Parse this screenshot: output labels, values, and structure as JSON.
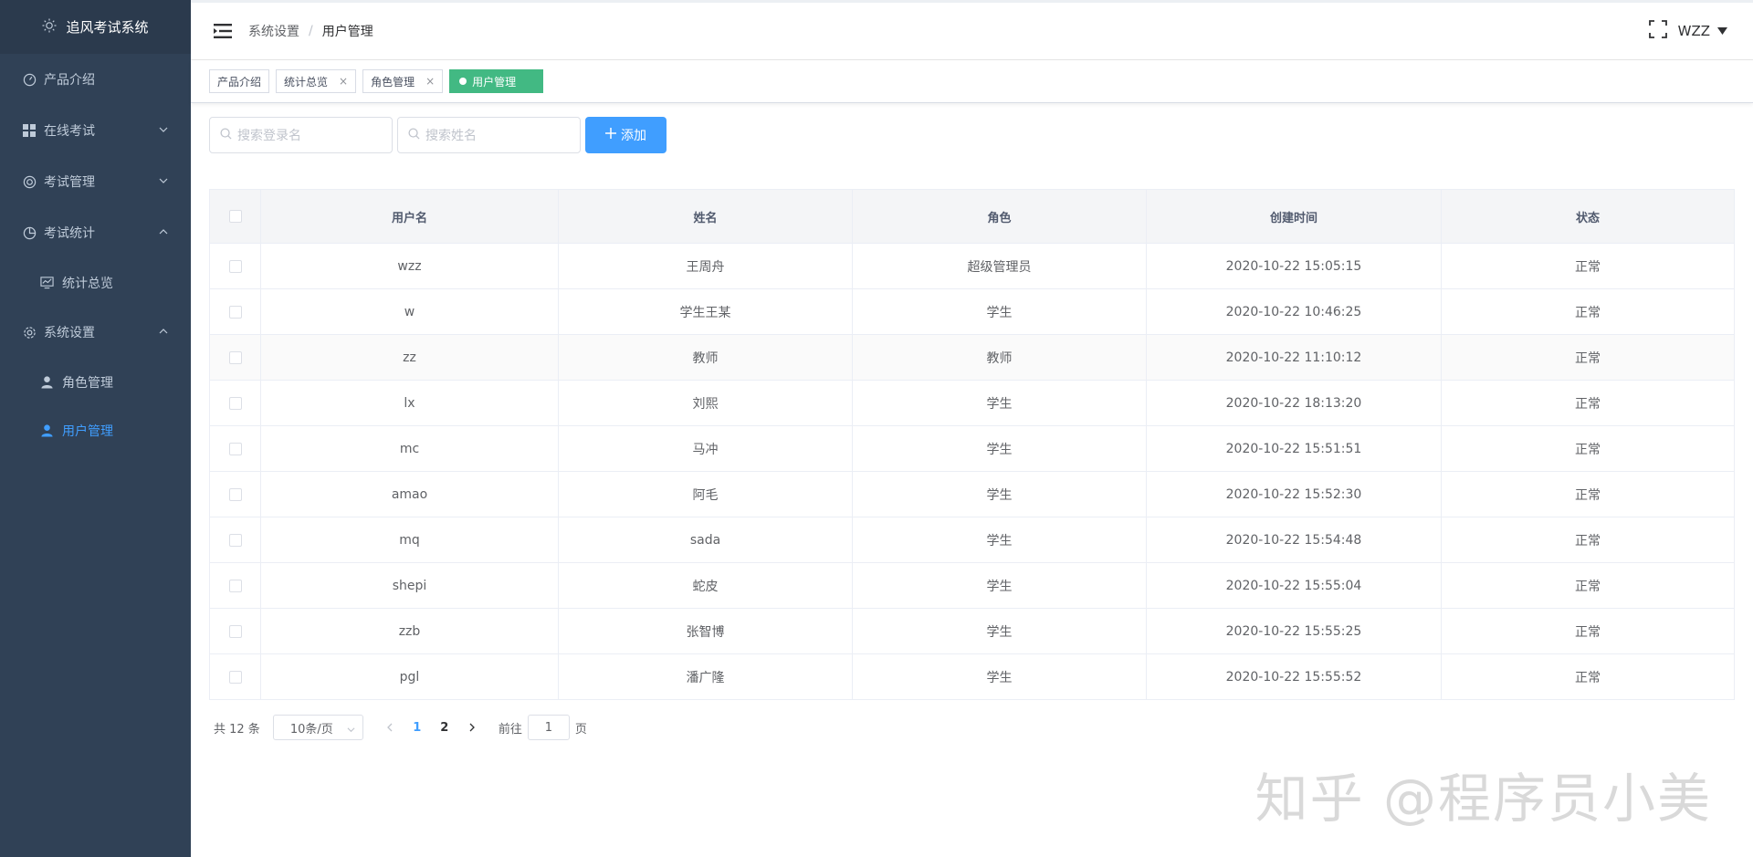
{
  "app": {
    "title": "追风考试系统"
  },
  "sidebar": {
    "items": [
      {
        "label": "产品介绍",
        "icon": "dashboard-icon"
      },
      {
        "label": "在线考试",
        "icon": "grid-icon",
        "arrow": "down"
      },
      {
        "label": "考试管理",
        "icon": "lifebuoy-icon",
        "arrow": "down"
      },
      {
        "label": "考试统计",
        "icon": "pie-chart-icon",
        "arrow": "up"
      },
      {
        "label": "统计总览",
        "icon": "monitor-chart-icon",
        "sub": true
      },
      {
        "label": "系统设置",
        "icon": "gear-icon",
        "arrow": "up"
      },
      {
        "label": "角色管理",
        "icon": "user-icon",
        "sub": true
      },
      {
        "label": "用户管理",
        "icon": "user-icon",
        "sub": true,
        "active": true
      }
    ]
  },
  "header": {
    "breadcrumb": [
      "系统设置",
      "用户管理"
    ],
    "user": "WZZ"
  },
  "tags": [
    {
      "label": "产品介绍",
      "closable": false
    },
    {
      "label": "统计总览",
      "closable": true
    },
    {
      "label": "角色管理",
      "closable": true
    },
    {
      "label": "用户管理",
      "active": true
    }
  ],
  "filters": {
    "login_placeholder": "搜索登录名",
    "name_placeholder": "搜索姓名",
    "add_label": "添加"
  },
  "table": {
    "columns": [
      "用户名",
      "姓名",
      "角色",
      "创建时间",
      "状态"
    ],
    "rows": [
      [
        "wzz",
        "王周舟",
        "超级管理员",
        "2020-10-22 15:05:15",
        "正常"
      ],
      [
        "w",
        "学生王某",
        "学生",
        "2020-10-22 10:46:25",
        "正常"
      ],
      [
        "zz",
        "教师",
        "教师",
        "2020-10-22 11:10:12",
        "正常"
      ],
      [
        "lx",
        "刘熙",
        "学生",
        "2020-10-22 18:13:20",
        "正常"
      ],
      [
        "mc",
        "马冲",
        "学生",
        "2020-10-22 15:51:51",
        "正常"
      ],
      [
        "amao",
        "阿毛",
        "学生",
        "2020-10-22 15:52:30",
        "正常"
      ],
      [
        "mq",
        "sada",
        "学生",
        "2020-10-22 15:54:48",
        "正常"
      ],
      [
        "shepi",
        "蛇皮",
        "学生",
        "2020-10-22 15:55:04",
        "正常"
      ],
      [
        "zzb",
        "张智博",
        "学生",
        "2020-10-22 15:55:25",
        "正常"
      ],
      [
        "pgl",
        "潘广隆",
        "学生",
        "2020-10-22 15:55:52",
        "正常"
      ]
    ]
  },
  "pagination": {
    "total_text": "共 12 条",
    "page_size": "10条/页",
    "pages": [
      "1",
      "2"
    ],
    "current": "1",
    "goto_prefix": "前往",
    "goto_value": "1",
    "goto_suffix": "页"
  },
  "watermark": "知乎 @程序员小美",
  "colors": {
    "sidebar_bg": "#304156",
    "accent": "#409eff",
    "active_tag": "#42b983"
  }
}
